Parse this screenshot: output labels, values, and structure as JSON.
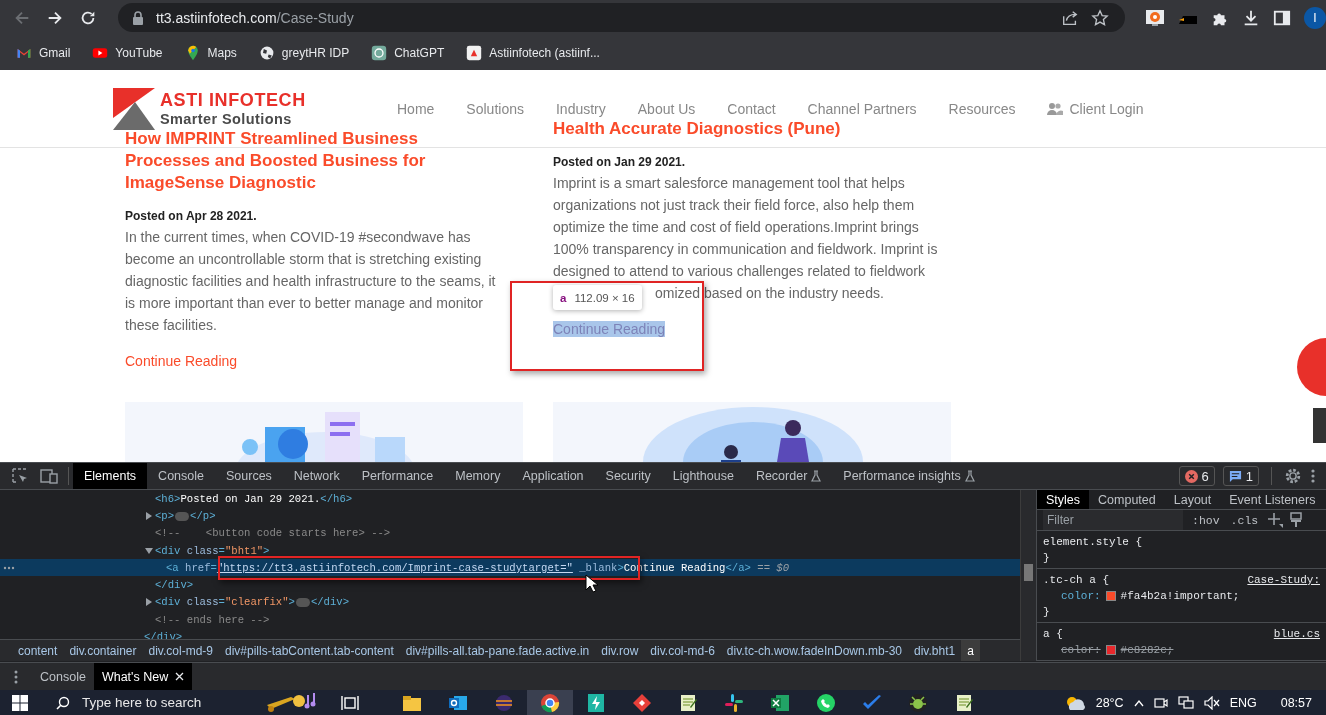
{
  "browser": {
    "back_disabled": true,
    "url_host": "tt3.astiinfotech.com",
    "url_path": "/Case-Study",
    "profile_initial": "I",
    "bookmarks": [
      {
        "label": "Gmail",
        "kind": "mail"
      },
      {
        "label": "YouTube",
        "kind": "video"
      },
      {
        "label": "Maps",
        "kind": "pin"
      },
      {
        "label": "greytHR IDP",
        "kind": "globe"
      },
      {
        "label": "ChatGPT",
        "kind": "chat"
      },
      {
        "label": "Astiinfotech (astiinf...",
        "kind": "page"
      }
    ]
  },
  "site": {
    "logo_title": "ASTI INFOTECH",
    "logo_subtitle": "Smarter Solutions",
    "nav": [
      {
        "label": "Home"
      },
      {
        "label": "Solutions"
      },
      {
        "label": "Industry"
      },
      {
        "label": "About Us"
      },
      {
        "label": "Contact"
      },
      {
        "label": "Channel Partners"
      },
      {
        "label": "Resources"
      },
      {
        "label": "Client Login",
        "kind": "login"
      }
    ],
    "articles": [
      {
        "title": "How IMPRINT Streamlined Business Processes and Boosted Business for ImageSense Diagnostic",
        "posted": "Posted on Apr 28 2021.",
        "body": "In the current times, when COVID-19 #secondwave has become an uncontrollable storm that is stretching existing diagnostic facilities and health infrastructure to the seams, it is more important than ever to better manage and monitor these facilities.",
        "link": "Continue Reading",
        "inspected": false
      },
      {
        "title": "Health Accurate Diagnostics (Pune)",
        "posted": "Posted on Jan 29 2021.",
        "body": "Imprint is a smart salesforce management tool that helps organizations not just track their field force, also help them optimize the time and cost of field operations.Imprint brings 100% transparency in communication and fieldwork. Imprint is designed to attend to various challenges related to fieldwork",
        "body_tail": "omized based on the industry needs.",
        "link": "Continue Reading",
        "inspected": true
      }
    ],
    "inspect_tooltip": {
      "tag": "a",
      "size": "112.09 × 16"
    }
  },
  "devtools": {
    "tabs": [
      {
        "label": "Elements",
        "selected": true
      },
      {
        "label": "Console",
        "selected": false
      },
      {
        "label": "Sources",
        "selected": false
      },
      {
        "label": "Network",
        "selected": false
      },
      {
        "label": "Performance",
        "selected": false
      },
      {
        "label": "Memory",
        "selected": false
      },
      {
        "label": "Application",
        "selected": false
      },
      {
        "label": "Security",
        "selected": false
      },
      {
        "label": "Lighthouse",
        "selected": false
      },
      {
        "label": "Recorder",
        "selected": false,
        "kind": "flask"
      },
      {
        "label": "Performance insights",
        "selected": false,
        "kind": "flask"
      }
    ],
    "errors": "6",
    "messages": "1",
    "tree": {
      "children": [
        {
          "line": [
            {
              "tag": "<h6>"
            },
            {
              "text": "Posted on Jan 29 2021."
            },
            {
              "tag": "</h6>"
            }
          ]
        },
        {
          "expanded": false,
          "line": [
            {
              "tag": "<p>"
            },
            {
              "dots": true
            },
            {
              "tag": "</p>"
            }
          ]
        },
        {
          "line": [
            {
              "comment": "<!--    <button code starts here> -->"
            }
          ]
        },
        {
          "expanded": true,
          "line": [
            {
              "tag": "<div "
            },
            {
              "attr": "class"
            },
            {
              "tag": "="
            },
            {
              "value": "\"bht1\""
            },
            {
              "tag": ">"
            }
          ],
          "children": [
            {
              "selected": true,
              "line": [
                {
                  "tag": "<a "
                },
                {
                  "attr": "href"
                },
                {
                  "tag": "="
                },
                {
                  "link": "\"https://tt3.astiinfotech.com/Imprint-case-studytarget=\""
                },
                {
                  "attr": " _blank"
                },
                {
                  "tag": ">"
                },
                {
                  "text": "Continue Reading"
                },
                {
                  "tag": "</a>"
                },
                {
                  "ref": " == $0"
                }
              ]
            }
          ],
          "close": [
            {
              "tag": "</div>"
            }
          ]
        },
        {
          "expanded": false,
          "line": [
            {
              "tag": "<div "
            },
            {
              "attr": "class"
            },
            {
              "tag": "="
            },
            {
              "value": "\"clearfix\""
            },
            {
              "tag": ">"
            },
            {
              "dots": true
            },
            {
              "tag": "</div>"
            }
          ]
        },
        {
          "line": [
            {
              "comment": "<!-- ends here -->"
            }
          ]
        }
      ],
      "close": [
        {
          "tag": "</div>"
        }
      ]
    },
    "breadcrumbs": [
      {
        "label": "content",
        "selected": false
      },
      {
        "label": "div.container",
        "selected": false
      },
      {
        "label": "div.col-md-9",
        "selected": false
      },
      {
        "label": "div#pills-tabContent.tab-content",
        "selected": false
      },
      {
        "label": "div#pills-all.tab-pane.fade.active.in",
        "selected": false
      },
      {
        "label": "div.row",
        "selected": false
      },
      {
        "label": "div.col-md-6",
        "selected": false
      },
      {
        "label": "div.tc-ch.wow.fadeInDown.mb-30",
        "selected": false
      },
      {
        "label": "div.bht1",
        "selected": false
      },
      {
        "label": "a",
        "selected": true
      }
    ],
    "side_tabs": [
      {
        "label": "Styles",
        "selected": true
      },
      {
        "label": "Computed",
        "selected": false
      },
      {
        "label": "Layout",
        "selected": false
      },
      {
        "label": "Event Listeners",
        "selected": false
      }
    ],
    "filter_placeholder": "Filter",
    "hov": ":hov",
    "cls": ".cls",
    "rules": [
      {
        "selector": "element.style {",
        "close": "}"
      },
      {
        "selector": ".tc-ch a {",
        "source": "Case-Study:",
        "props": [
          {
            "name": "color:",
            "value": "#fa4b2a!important;",
            "color": "#fa4b2a",
            "overridden": false
          }
        ],
        "close": "}"
      },
      {
        "selector": "a {",
        "source": "blue.cs",
        "props": [
          {
            "name": "color:",
            "value": "#e8282c;",
            "color": "#e8282c",
            "overridden": true
          }
        ]
      }
    ],
    "drawer_tabs": [
      {
        "label": "Console",
        "selected": false
      },
      {
        "label": "What's New",
        "selected": true
      }
    ]
  },
  "taskbar": {
    "search_placeholder": "Type here to search",
    "apps": [
      {
        "kind": "folder",
        "selected": false
      },
      {
        "kind": "mail",
        "selected": false
      },
      {
        "kind": "eclipse",
        "selected": false
      },
      {
        "kind": "browser",
        "selected": true
      },
      {
        "kind": "bolt",
        "selected": false
      },
      {
        "kind": "diamond",
        "selected": false
      },
      {
        "kind": "notepad",
        "selected": false
      },
      {
        "kind": "slack",
        "selected": false
      },
      {
        "kind": "sheet",
        "selected": false
      },
      {
        "kind": "phone",
        "selected": false
      },
      {
        "kind": "check",
        "selected": false
      },
      {
        "kind": "bug",
        "selected": false
      },
      {
        "kind": "notepad",
        "selected": false
      }
    ],
    "weather": "28°C",
    "language": "ENG",
    "time": "08:57"
  }
}
